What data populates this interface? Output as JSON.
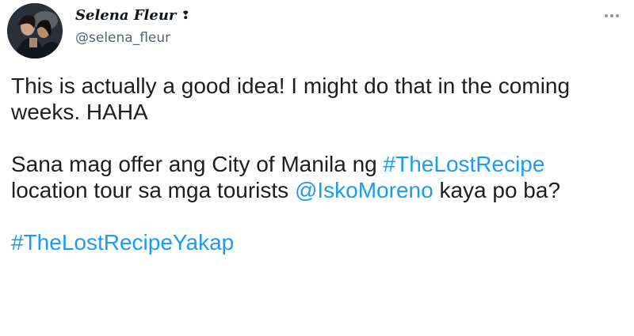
{
  "author": {
    "display_name": "Selena Fleur",
    "name_emoji": "❢",
    "handle": "@selena_fleur"
  },
  "menu": {
    "more_icon": "more-horizontal-icon"
  },
  "tweet": {
    "p1": "This is actually a good idea! I might do that in the coming weeks. HAHA",
    "p2_a": "Sana mag offer ang City of Manila ng ",
    "p2_hashtag": "#TheLostRecipe",
    "p2_b": " location tour sa mga tourists ",
    "p2_mention": "@IskoMoreno",
    "p2_c": " kaya po ba?",
    "p3_hashtag": "#TheLostRecipeYakap"
  },
  "colors": {
    "link": "#1d9bf0",
    "secondary_text": "#536471",
    "primary_text": "#0f1419"
  }
}
